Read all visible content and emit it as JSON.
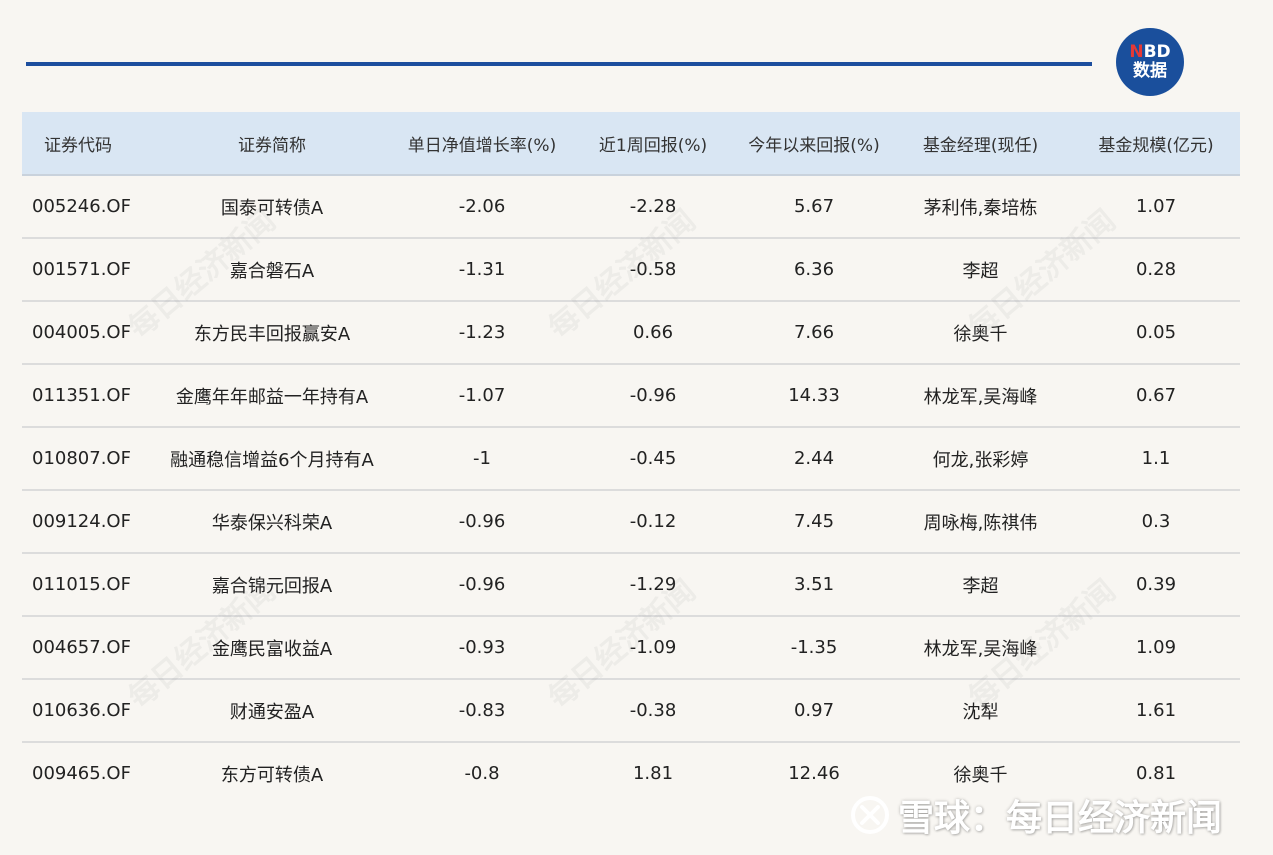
{
  "logo": {
    "line1_n": "N",
    "line1_rest": "BD",
    "line2": "数据"
  },
  "table": {
    "headers": [
      "证券代码",
      "证券简称",
      "单日净值增长率(%)",
      "近1周回报(%)",
      "今年以来回报(%)",
      "基金经理(现任)",
      "基金规模(亿元)"
    ],
    "rows": [
      [
        "005246.OF",
        "国泰可转债A",
        "-2.06",
        "-2.28",
        "5.67",
        "茅利伟,秦培栋",
        "1.07"
      ],
      [
        "001571.OF",
        "嘉合磐石A",
        "-1.31",
        "-0.58",
        "6.36",
        "李超",
        "0.28"
      ],
      [
        "004005.OF",
        "东方民丰回报赢安A",
        "-1.23",
        "0.66",
        "7.66",
        "徐奥千",
        "0.05"
      ],
      [
        "011351.OF",
        "金鹰年年邮益一年持有A",
        "-1.07",
        "-0.96",
        "14.33",
        "林龙军,吴海峰",
        "0.67"
      ],
      [
        "010807.OF",
        "融通稳信增益6个月持有A",
        "-1",
        "-0.45",
        "2.44",
        "何龙,张彩婷",
        "1.1"
      ],
      [
        "009124.OF",
        "华泰保兴科荣A",
        "-0.96",
        "-0.12",
        "7.45",
        "周咏梅,陈祺伟",
        "0.3"
      ],
      [
        "011015.OF",
        "嘉合锦元回报A",
        "-0.96",
        "-1.29",
        "3.51",
        "李超",
        "0.39"
      ],
      [
        "004657.OF",
        "金鹰民富收益A",
        "-0.93",
        "-1.09",
        "-1.35",
        "林龙军,吴海峰",
        "1.09"
      ],
      [
        "010636.OF",
        "财通安盈A",
        "-0.83",
        "-0.38",
        "0.97",
        "沈犁",
        "1.61"
      ],
      [
        "009465.OF",
        "东方可转债A",
        "-0.8",
        "1.81",
        "12.46",
        "徐奥千",
        "0.81"
      ]
    ]
  },
  "watermark_text": "每日经济新闻",
  "footer": {
    "text": "雪球：每日经济新闻"
  },
  "colors": {
    "accent": "#1d4e9e",
    "header_bg": "#d9e6f3",
    "logo_red": "#e53935"
  }
}
